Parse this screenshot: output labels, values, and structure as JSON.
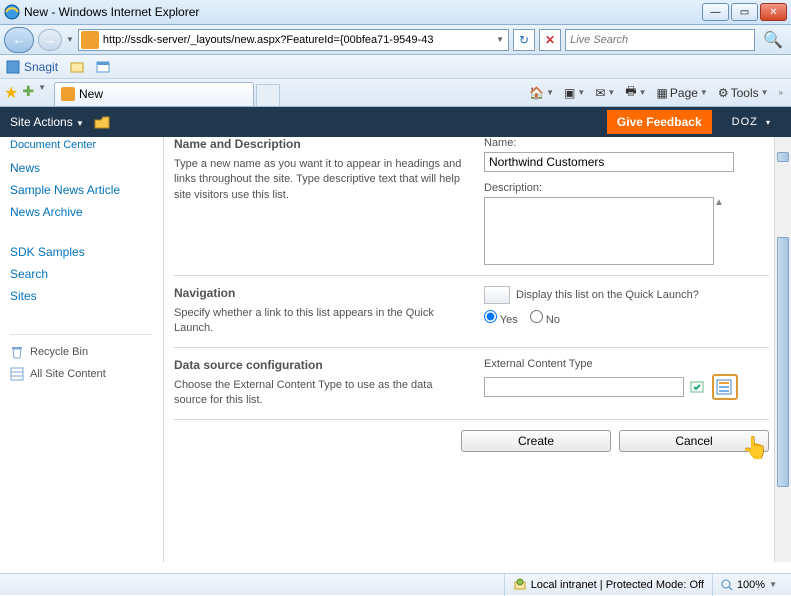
{
  "window": {
    "title": "New - Windows Internet Explorer"
  },
  "nav": {
    "url": "http://ssdk-server/_layouts/new.aspx?FeatureId={00bfea71-9549-43",
    "search_placeholder": "Live Search"
  },
  "linksbar": {
    "snagit": "Snagit"
  },
  "tab": {
    "title": "New"
  },
  "tools": {
    "page": "Page",
    "tools": "Tools"
  },
  "ribbon": {
    "site_actions": "Site Actions",
    "feedback": "Give Feedback",
    "user": "DOZ"
  },
  "leftnav": {
    "truncated": "Document Center",
    "items": [
      "News",
      "Sample News Article",
      "News Archive"
    ],
    "items2": [
      "SDK Samples",
      "Search",
      "Sites"
    ],
    "recycle": "Recycle Bin",
    "allcontent": "All Site Content"
  },
  "sections": {
    "name": {
      "title": "Name and Description",
      "desc": "Type a new name as you want it to appear in headings and links throughout the site. Type descriptive text that will help site visitors use this list.",
      "name_label": "Name:",
      "name_value": "Northwind Customers",
      "desc_label": "Description:"
    },
    "navsec": {
      "title": "Navigation",
      "desc": "Specify whether a link to this list appears in the Quick Launch.",
      "prompt": "Display this list on the Quick Launch?",
      "yes": "Yes",
      "no": "No"
    },
    "dsc": {
      "title": "Data source configuration",
      "desc": "Choose the External Content Type to use as the data source for this list.",
      "label": "External Content Type"
    }
  },
  "buttons": {
    "create": "Create",
    "cancel": "Cancel"
  },
  "status": {
    "zone": "Local intranet | Protected Mode: Off",
    "zoom": "100%"
  }
}
